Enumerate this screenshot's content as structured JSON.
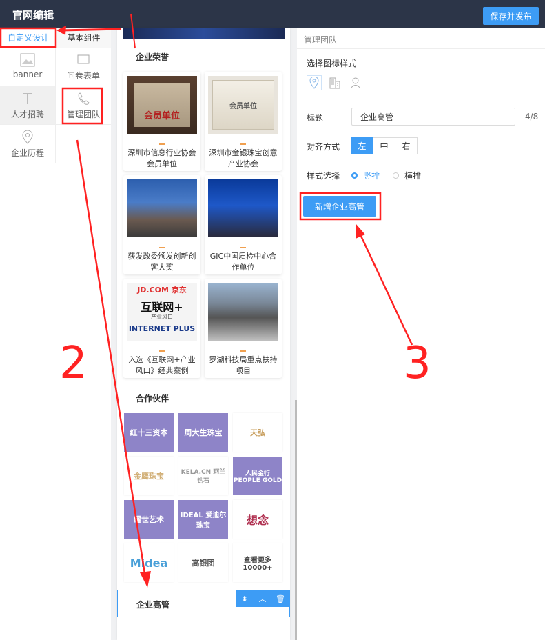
{
  "topbar": {
    "title": "官网编辑",
    "publish_label": "保存并发布"
  },
  "left": {
    "tabs": [
      "自定义设计",
      "基本组件"
    ],
    "components": [
      {
        "label": "banner",
        "icon": "image-icon"
      },
      {
        "label": "问卷表单",
        "icon": "form-icon"
      },
      {
        "label": "人才招聘",
        "icon": "text-icon"
      },
      {
        "label": "管理团队",
        "icon": "phone-icon"
      },
      {
        "label": "企业历程",
        "icon": "location-icon"
      }
    ]
  },
  "canvas": {
    "honor_title": "企业荣誉",
    "honors": [
      {
        "caption": "深圳市信息行业协会会员单位"
      },
      {
        "caption": "深圳市金银珠宝创意产业协会"
      },
      {
        "caption": "获发改委颁发创新创客大奖"
      },
      {
        "caption": "GIC中国质检中心合作单位"
      },
      {
        "caption": "入选《互联网+产业风口》经典案例"
      },
      {
        "caption": "罗湖科技局重点扶持项目"
      }
    ],
    "honor_image_text": {
      "plaque_1": "会员单位",
      "plaque_2": "会员单位",
      "poster_title": "互联网+",
      "poster_sub": "产业风口",
      "poster_en": "INTERNET PLUS",
      "poster_top": "JD.COM 京东"
    },
    "partner_title": "合作伙伴",
    "partners": [
      "红十三资本",
      "周大生珠宝",
      "天弘",
      "金鹰珠宝",
      "KELA.CN 珂兰钻石",
      "人民金行 PEOPLE GOLD",
      "耀世艺术",
      "IDEAL 爱迪尔珠宝",
      "想念",
      "Midea",
      "高银团",
      "查看更多 10000+"
    ],
    "selected_block_label": "企业高管"
  },
  "right": {
    "header": "管理团队",
    "icon_style_label": "选择图标样式",
    "title_label": "标题",
    "title_value": "企业高管",
    "title_count": "4/8",
    "align_label": "对齐方式",
    "align_options": [
      "左",
      "中",
      "右"
    ],
    "style_label": "样式选择",
    "style_options": [
      "竖排",
      "横排"
    ],
    "add_button": "新增企业高管"
  },
  "annotations": [
    "2",
    "3"
  ],
  "colors": {
    "accent": "#3d9cf5",
    "topbar": "#2c3548",
    "annotation": "#ff2222",
    "partner_purple": "#8e84c8"
  }
}
